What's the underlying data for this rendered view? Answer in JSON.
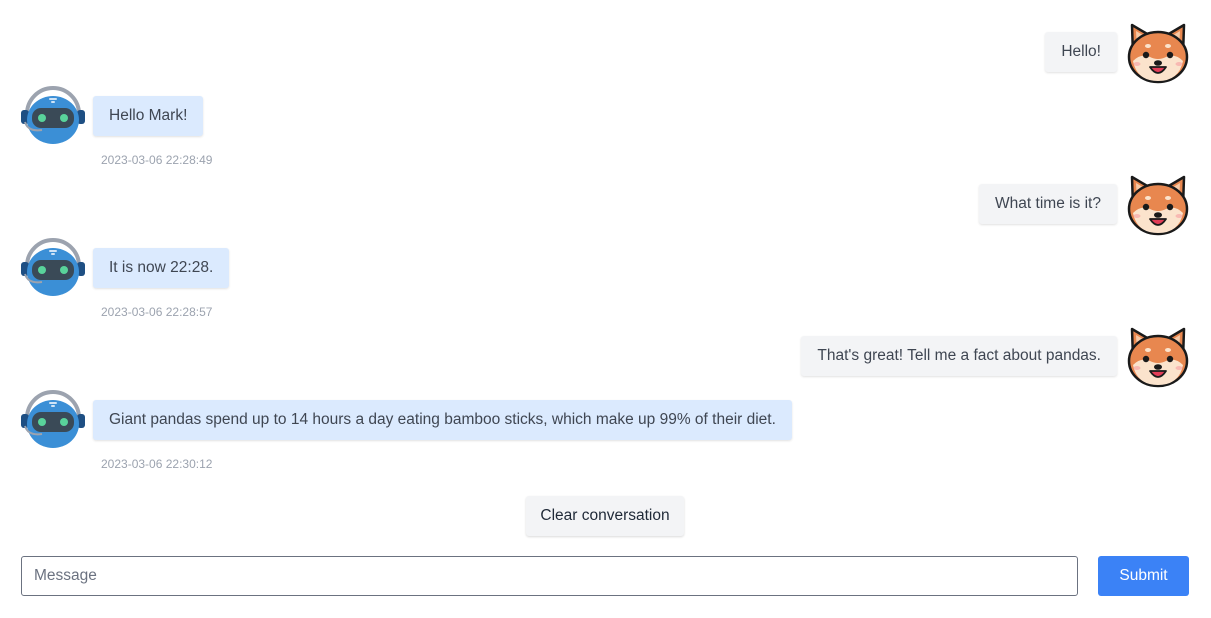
{
  "colors": {
    "user_bubble": "#f3f4f6",
    "bot_bubble": "#dbeafe",
    "submit": "#3b82f6",
    "timestamp": "#9ca3af"
  },
  "messages": [
    {
      "role": "user",
      "text": "Hello!",
      "avatar": "shiba-dog-icon"
    },
    {
      "role": "bot",
      "text": "Hello Mark!",
      "time": "2023-03-06 22:28:49",
      "avatar": "robot-headset-icon"
    },
    {
      "role": "user",
      "text": "What time is it?",
      "avatar": "shiba-dog-icon"
    },
    {
      "role": "bot",
      "text": "It is now 22:28.",
      "time": "2023-03-06 22:28:57",
      "avatar": "robot-headset-icon"
    },
    {
      "role": "user",
      "text": "That's great! Tell me a fact about pandas.",
      "avatar": "shiba-dog-icon"
    },
    {
      "role": "bot",
      "text": "Giant pandas spend up to 14 hours a day eating bamboo sticks, which make up 99% of their diet.",
      "time": "2023-03-06 22:30:12",
      "avatar": "robot-headset-icon"
    }
  ],
  "controls": {
    "clear_label": "Clear conversation",
    "input_value": "",
    "input_placeholder": "Message",
    "submit_label": "Submit"
  }
}
